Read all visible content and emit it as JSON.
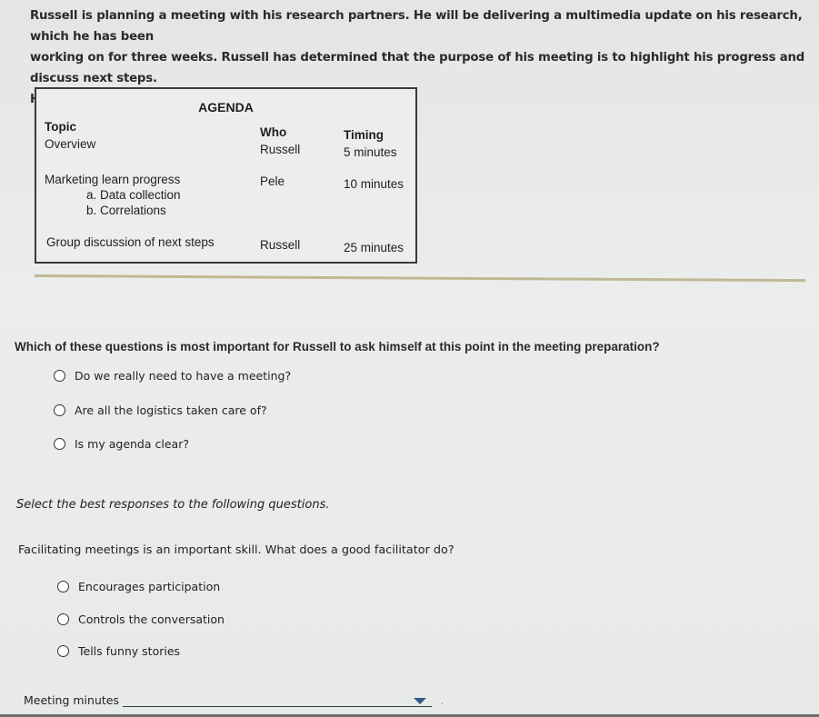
{
  "intro": {
    "lines": [
      "Russell is planning a meeting with his research partners. He will be delivering a multimedia update on his research, which he has been",
      "working on for three weeks. Russell has determined that the purpose of his meeting is to highlight his progress and discuss next steps.",
      "He is satisfied with his agenda:"
    ]
  },
  "agenda": {
    "title": "AGENDA",
    "headers": {
      "topic": "Topic",
      "who": "Who",
      "timing": "Timing"
    },
    "rows": [
      {
        "topic": "Overview",
        "who": "Russell",
        "timing": "5 minutes",
        "subitems": []
      },
      {
        "topic": "Marketing learn progress",
        "who": "Pele",
        "timing": "10 minutes",
        "subitems": [
          "a. Data collection",
          "b. Correlations"
        ]
      },
      {
        "topic": "Group discussion of next steps",
        "who": "Russell",
        "timing": "25 minutes",
        "subitems": []
      }
    ]
  },
  "question1": {
    "prompt": "Which of these questions is most important for Russell to ask himself at this point in the meeting preparation?",
    "options": [
      "Do we really need to have a meeting?",
      "Are all the logistics taken care of?",
      "Is my agenda clear?"
    ],
    "selected": null
  },
  "instructions": "Select the best responses to the following questions.",
  "question2": {
    "prompt": "Facilitating meetings is an important skill. What does a good facilitator do?",
    "options": [
      "Encourages participation",
      "Controls the conversation",
      "Tells funny stories"
    ],
    "selected": null
  },
  "dropdown": {
    "label": "Meeting minutes",
    "value": "",
    "suffix": "."
  }
}
